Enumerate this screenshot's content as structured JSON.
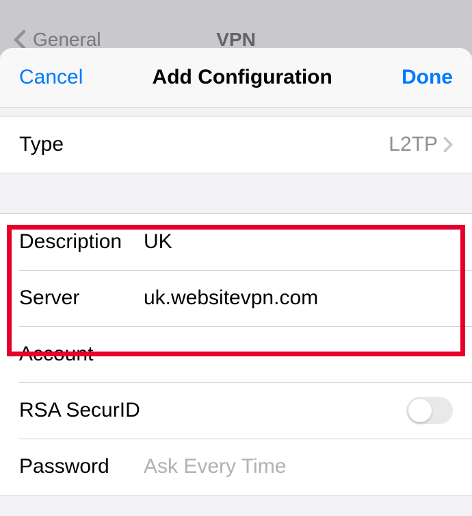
{
  "background": {
    "back_label": "General",
    "title": "VPN"
  },
  "header": {
    "cancel": "Cancel",
    "title": "Add Configuration",
    "done": "Done"
  },
  "type_row": {
    "label": "Type",
    "value": "L2TP"
  },
  "fields": {
    "description": {
      "label": "Description",
      "value": "UK"
    },
    "server": {
      "label": "Server",
      "value": "uk.websitevpn.com"
    },
    "account": {
      "label": "Account",
      "value": ""
    },
    "rsa": {
      "label": "RSA SecurID"
    },
    "password": {
      "label": "Password",
      "placeholder": "Ask Every Time",
      "value": ""
    }
  }
}
